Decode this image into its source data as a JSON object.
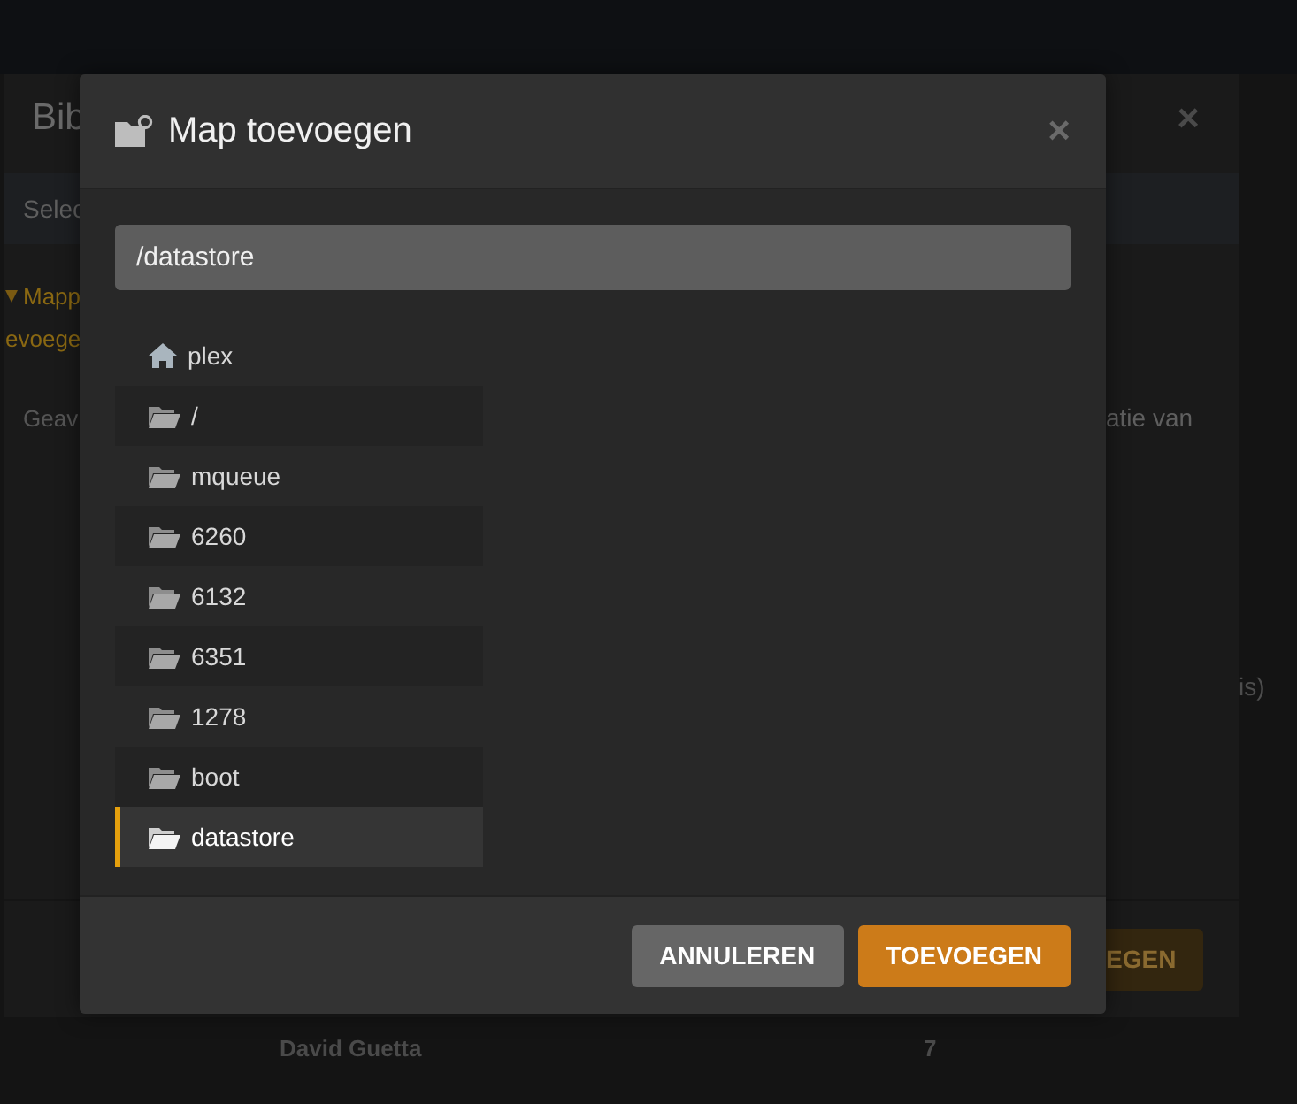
{
  "background": {
    "title": "Bib",
    "close": "×",
    "subtitle": "Selec",
    "notice_lines": [
      "Mapp",
      "evoege"
    ],
    "hint_left": "Geav",
    "hint_right": "atie van",
    "side_note": "is)",
    "action": "EGEN",
    "rows": [
      {
        "name": "David Guetta",
        "count": "7"
      }
    ]
  },
  "dialog": {
    "title": "Map toevoegen",
    "close": "×",
    "path": "/datastore",
    "items": [
      {
        "kind": "home",
        "label": "plex",
        "selected": false
      },
      {
        "kind": "folder",
        "label": "/",
        "selected": false
      },
      {
        "kind": "folder",
        "label": "mqueue",
        "selected": false
      },
      {
        "kind": "folder",
        "label": "6260",
        "selected": false
      },
      {
        "kind": "folder",
        "label": "6132",
        "selected": false
      },
      {
        "kind": "folder",
        "label": "6351",
        "selected": false
      },
      {
        "kind": "folder",
        "label": "1278",
        "selected": false
      },
      {
        "kind": "folder",
        "label": "boot",
        "selected": false
      },
      {
        "kind": "folder",
        "label": "datastore",
        "selected": true
      }
    ],
    "buttons": [
      {
        "kind": "secondary",
        "label": "ANNULEREN"
      },
      {
        "kind": "primary",
        "label": "TOEVOEGEN"
      }
    ]
  }
}
